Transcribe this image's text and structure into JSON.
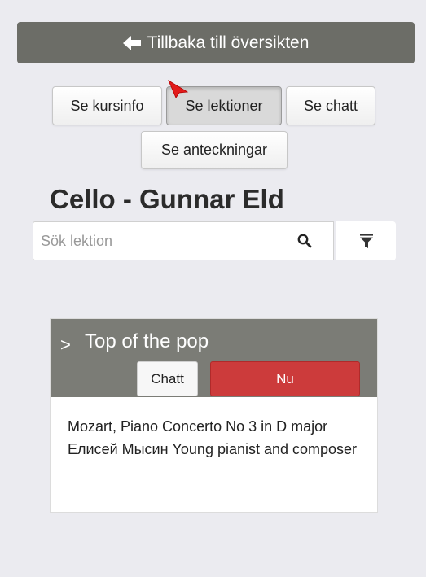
{
  "nav": {
    "back_label": "Tillbaka till översikten"
  },
  "tabs": [
    {
      "label": "Se kursinfo",
      "active": false
    },
    {
      "label": "Se lektioner",
      "active": true
    },
    {
      "label": "Se chatt",
      "active": false
    },
    {
      "label": "Se anteckningar",
      "active": false
    }
  ],
  "course": {
    "title": "Cello - Gunnar Eld"
  },
  "search": {
    "placeholder": "Sök lektion",
    "value": "",
    "icon": "search-icon",
    "filter_icon": "filter-icon"
  },
  "lesson": {
    "title": "Top of the pop",
    "chat_label": "Chatt",
    "now_label": "Nu",
    "description": "Mozart, Piano Concerto No 3 in D major Елисей Мысин Young pianist and composer"
  },
  "colors": {
    "header_bar": "#6c6d67",
    "card_header": "#7b7c76",
    "now_button": "#cc3b3b",
    "pointer": "#e21b1b",
    "background": "#ebebf0"
  }
}
